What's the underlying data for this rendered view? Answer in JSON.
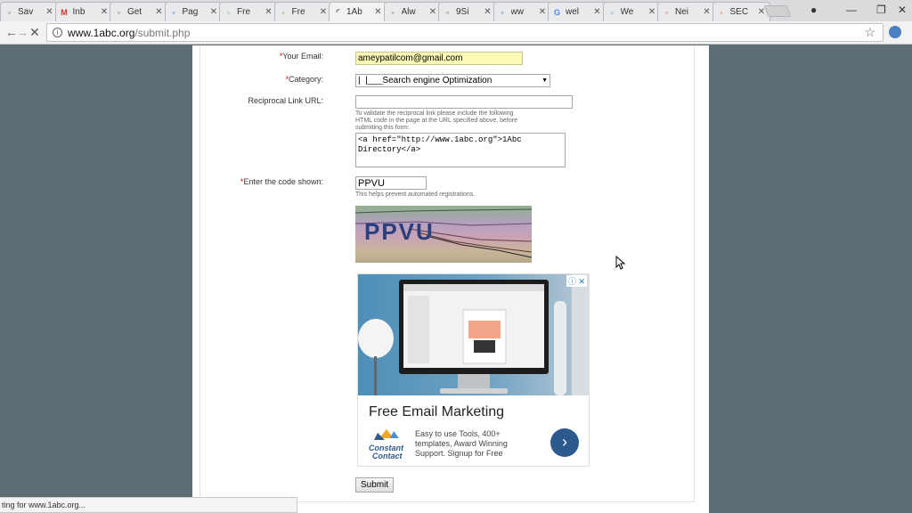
{
  "browser": {
    "tabs": [
      {
        "title": "Sav",
        "favicon": "page-icon",
        "color": "#666666"
      },
      {
        "title": "Inb",
        "favicon": "gmail-icon",
        "color": "#d93025"
      },
      {
        "title": "Get",
        "favicon": "page-icon",
        "color": "#666666"
      },
      {
        "title": "Pag",
        "favicon": "a-logo-icon",
        "color": "#1a73e8"
      },
      {
        "title": "Fre",
        "favicon": "leaf-icon",
        "color": "#6aa84f"
      },
      {
        "title": "Fre",
        "favicon": "leaf-icon",
        "color": "#6aa84f"
      },
      {
        "title": "1Ab",
        "favicon": "loading-icon",
        "color": "#555555"
      },
      {
        "title": "Alw",
        "favicon": "page-icon",
        "color": "#666666"
      },
      {
        "title": "9Si",
        "favicon": "page-icon",
        "color": "#666666"
      },
      {
        "title": "ww",
        "favicon": "grid-logo-icon",
        "color": "#2a6fb8"
      },
      {
        "title": "wel",
        "favicon": "google-icon",
        "color": "#4285f4"
      },
      {
        "title": "We",
        "favicon": "swirl-icon",
        "color": "#4a86c8"
      },
      {
        "title": "Nei",
        "favicon": "avatar-icon",
        "color": "#c0604f"
      },
      {
        "title": "SEC",
        "favicon": "star-burst-icon",
        "color": "#e8711c"
      }
    ],
    "url_host": "www.1abc.org",
    "url_path": "/submit.php",
    "status_text": "ting for www.1abc.org..."
  },
  "form": {
    "email_label": "Your Email:",
    "email_value": "ameypatilcom@gmail.com",
    "category_label": "Category:",
    "category_value": "|  |___Search engine Optimization",
    "reciprocal_label": "Reciprocal Link URL:",
    "reciprocal_value": "",
    "reciprocal_hint": "To validate the reciprocal link please include the following HTML code in the page at the URL specified above, before submiting this form:",
    "reciprocal_code": "<a href=\"http://www.1abc.org\">1Abc Directory</a>",
    "code_label": "Enter the code shown:",
    "code_value": "PPVU",
    "code_hint": "This helps prevent automated registrations.",
    "captcha_text": "PPVU",
    "required_marker": "*",
    "submit_label": "Submit"
  },
  "ad": {
    "title": "Free Email Marketing",
    "text": "Easy to use Tools, 400+\ntemplates, Award Winning\nSupport. Signup for Free",
    "brand_line1": "Constant",
    "brand_line2": "Contact",
    "choices_icons": "ⓘ ✕"
  }
}
